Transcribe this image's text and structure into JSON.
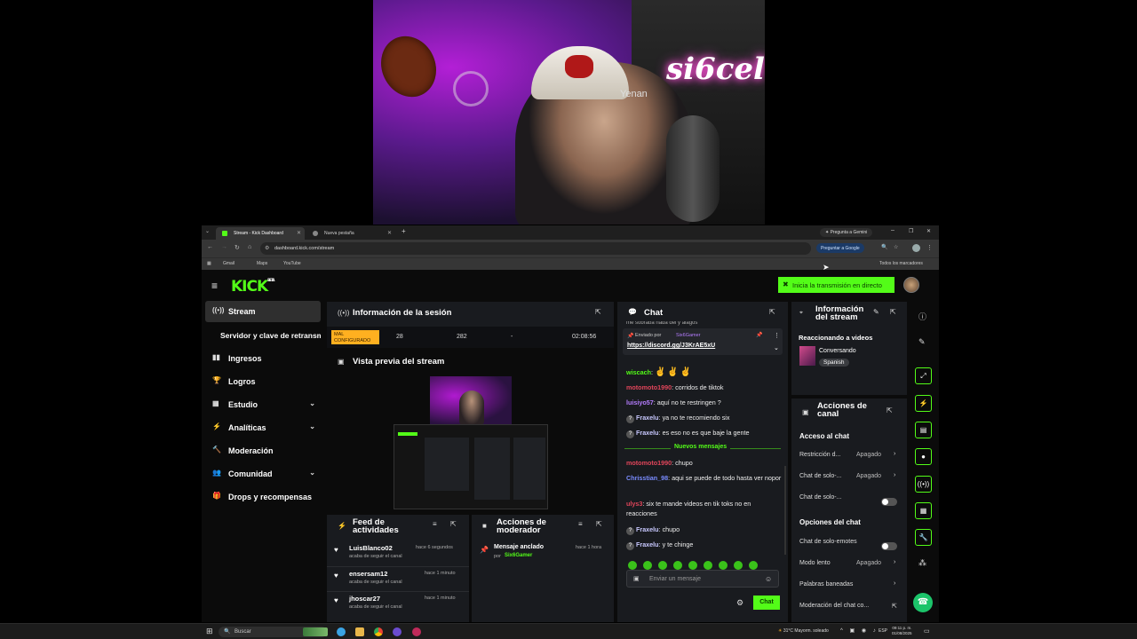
{
  "webcam": {
    "neon_sign": "si6cel",
    "cap_text": "Yenan"
  },
  "browser": {
    "tabs": [
      {
        "label": "Stream - Kick Dashboard",
        "active": true
      },
      {
        "label": "Nueva pestaña",
        "active": false
      }
    ],
    "gemini_tab_button": "Pregunta a Gemini",
    "url": "dashboard.kick.com/stream",
    "google_button": "Preguntar a Google",
    "bookmarks": [
      "Gmail",
      "Maps",
      "YouTube"
    ],
    "all_bookmarks": "Todos los marcadores"
  },
  "kick": {
    "logo": "KICK",
    "logo_badge": "BETA",
    "go_live_button": "Inicia la transmisión en directo",
    "sidebar": [
      {
        "label": "Stream",
        "icon": "stream-icon",
        "active": true
      },
      {
        "label": "Servidor y clave de retransmisión",
        "sub": true
      },
      {
        "label": "Ingresos",
        "icon": "chart-icon"
      },
      {
        "label": "Logros",
        "icon": "trophy-icon"
      },
      {
        "label": "Estudio",
        "icon": "studio-icon",
        "expandable": true
      },
      {
        "label": "Analíticas",
        "icon": "analytics-icon",
        "expandable": true
      },
      {
        "label": "Moderación",
        "icon": "hammer-icon"
      },
      {
        "label": "Comunidad",
        "icon": "community-icon",
        "expandable": true
      },
      {
        "label": "Drops y recompensas",
        "icon": "drops-icon"
      }
    ],
    "session": {
      "title": "Información de la sesión",
      "status": "MAL CONFIGURADO",
      "stats": [
        "28",
        "282",
        "-",
        "02:08:56"
      ]
    },
    "preview": {
      "title": "Vista previa del stream"
    },
    "activity_feed": {
      "title": "Feed de actividades",
      "items": [
        {
          "user": "LuisBlanco02",
          "action": "acaba de seguir el canal",
          "time": "hace 6 segundos"
        },
        {
          "user": "ensersam12",
          "action": "acaba de seguir el canal",
          "time": "hace 1 minuto"
        },
        {
          "user": "jhoscar27",
          "action": "acaba de seguir el canal",
          "time": "hace 1 minuto"
        }
      ]
    },
    "mod_actions": {
      "title": "Acciones de moderador",
      "items": [
        {
          "action": "Mensaje anclado",
          "by_label": "por",
          "by": "Six6Gamer",
          "time": "hace 1 hora"
        }
      ]
    },
    "chat": {
      "title": "Chat",
      "truncated_top": "me sobraba nada del y alagos",
      "pinned": {
        "label": "Enviado por",
        "by": "Six6Gamer",
        "link": "https://discord.gg/J3KrAE5xU"
      },
      "messages": [
        {
          "user": "wiscach",
          "text": "",
          "color": "#53fc18",
          "emotes": true
        },
        {
          "user": "motomoto1990",
          "text": "corridos de tiktok",
          "color": "#e0455a"
        },
        {
          "user": "luisiyo57",
          "text": "aquí no te restringen ?",
          "color": "#b57dff"
        },
        {
          "user": "Fraxelu",
          "text": "ya no te recomiendo six",
          "color": "#c8c8ff",
          "mod": true
        },
        {
          "user": "Fraxelu",
          "text": "es eso no es que baje la gente",
          "color": "#c8c8ff",
          "mod": true
        }
      ],
      "divider": "Nuevos mensajes",
      "new_messages": [
        {
          "user": "motomoto1990",
          "text": "chupo",
          "color": "#e0455a"
        },
        {
          "user": "Chrisstian_98",
          "text": "aqui se puede de todo hasta ver nopor",
          "color": "#7a8cff"
        },
        {
          "user": "ulys3",
          "text": "six te mande videos en tik toks no en reacciones",
          "color": "#e0455a"
        },
        {
          "user": "Fraxelu",
          "text": "chupo",
          "color": "#c8c8ff",
          "mod": true
        },
        {
          "user": "Fraxelu",
          "text": "y te chinge",
          "color": "#c8c8ff",
          "mod": true
        }
      ],
      "input_placeholder": "Enviar un mensaje",
      "send_button": "Chat"
    },
    "stream_info": {
      "title": "Información del stream",
      "category": "Reaccionando a videos",
      "subtitle": "Conversando",
      "language": "Spanish"
    },
    "channel_actions": {
      "title": "Acciones de canal",
      "chat_access_heading": "Acceso al chat",
      "chat_access": [
        {
          "label": "Restricción d...",
          "value": "Apagado",
          "type": "link"
        },
        {
          "label": "Chat de solo-...",
          "value": "Apagado",
          "type": "link"
        },
        {
          "label": "Chat de solo-...",
          "value": "",
          "type": "toggle"
        }
      ],
      "chat_options_heading": "Opciones del chat",
      "chat_options": [
        {
          "label": "Chat de solo-emotes",
          "value": "",
          "type": "toggle"
        },
        {
          "label": "Modo lento",
          "value": "Apagado",
          "type": "link"
        },
        {
          "label": "Palabras baneadas",
          "value": "",
          "type": "link"
        },
        {
          "label": "Moderación del chat co...",
          "value": "",
          "type": "external"
        }
      ]
    }
  },
  "taskbar": {
    "search_placeholder": "Buscar",
    "weather": "31°C  Mayorm. soleado",
    "language": "ESP",
    "time": "09:11 p. m.",
    "date": "01/08/2025"
  }
}
